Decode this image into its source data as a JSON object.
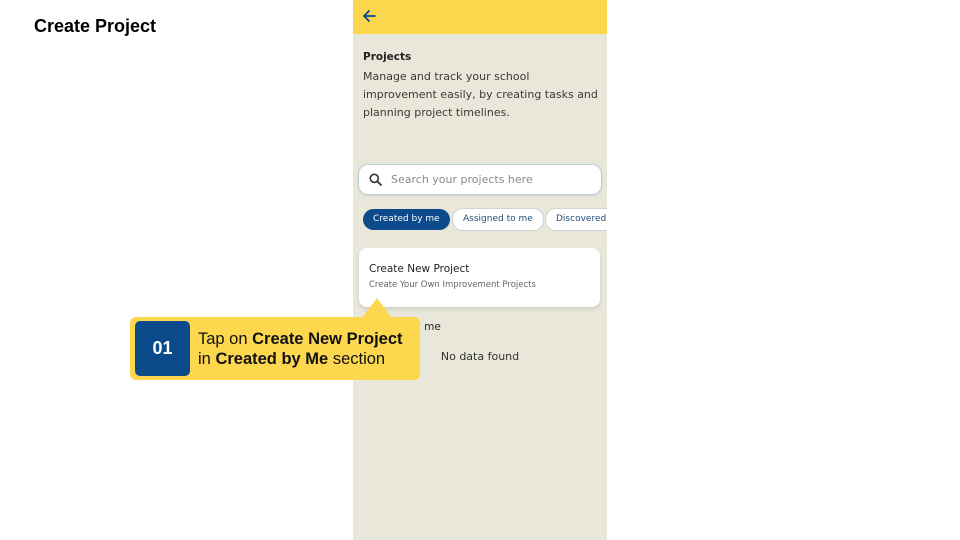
{
  "slide": {
    "title": "Create Project"
  },
  "app": {
    "heading": "Projects",
    "description": "Manage and track your school improvement easily, by creating tasks and planning project timelines.",
    "search": {
      "placeholder": "Search your projects here"
    },
    "tabs": [
      {
        "label": "Created by me",
        "active": true
      },
      {
        "label": "Assigned to me",
        "active": false
      },
      {
        "label": "Discovered",
        "active": false
      }
    ],
    "create_card": {
      "title": "Create New Project",
      "subtitle": "Create Your Own Improvement Projects"
    },
    "section_label": "Created by me",
    "empty_text": "No data found"
  },
  "callout": {
    "step": "01",
    "line1_prefix": "Tap on ",
    "line1_bold": "Create New Project",
    "line2_prefix": "in ",
    "line2_bold": "Created by Me",
    "line2_suffix": " section"
  },
  "colors": {
    "accent_yellow": "#fdd84f",
    "brand_blue": "#0b4a8b",
    "app_background": "#e9e7d9"
  },
  "icons": {
    "back": "arrow-left-icon",
    "search": "search-icon"
  }
}
